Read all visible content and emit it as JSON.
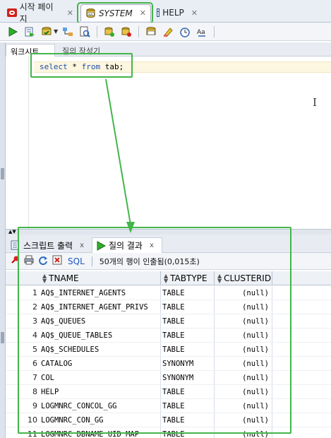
{
  "tabs": [
    {
      "label": "시작 페이지",
      "icon": "oracle-icon"
    },
    {
      "label": "SYSTEM",
      "icon": "sql-worksheet-icon",
      "active": true
    },
    {
      "label": "HELP",
      "icon": "table-icon"
    }
  ],
  "toolbar_icons": [
    "run-statement-icon",
    "run-script-icon",
    "commit-icon",
    "dropdown-icon",
    "explain-plan-icon",
    "autotrace-icon",
    "sql-tuning-icon",
    "rollback-icon",
    "unshared-sql-icon",
    "clear-icon",
    "history-icon",
    "format-case-icon"
  ],
  "subtabs": {
    "worksheet": "워크시트",
    "query_builder": "질의 작성기"
  },
  "editor": {
    "keyword_select": "select",
    "star": " * ",
    "keyword_from": "from",
    "rest": " tab;"
  },
  "results": {
    "tab_script_output": "스크립트 출력",
    "tab_query_result": "질의 결과",
    "sql_link": "SQL",
    "status": "50개의 행이 인출됨(0,015초)"
  },
  "grid": {
    "columns": [
      "TNAME",
      "TABTYPE",
      "CLUSTERID"
    ],
    "rows": [
      {
        "n": "1",
        "tname": "AQ$_INTERNET_AGENTS",
        "tabtype": "TABLE",
        "clusterid": "(null)"
      },
      {
        "n": "2",
        "tname": "AQ$_INTERNET_AGENT_PRIVS",
        "tabtype": "TABLE",
        "clusterid": "(null)"
      },
      {
        "n": "3",
        "tname": "AQ$_QUEUES",
        "tabtype": "TABLE",
        "clusterid": "(null)"
      },
      {
        "n": "4",
        "tname": "AQ$_QUEUE_TABLES",
        "tabtype": "TABLE",
        "clusterid": "(null)"
      },
      {
        "n": "5",
        "tname": "AQ$_SCHEDULES",
        "tabtype": "TABLE",
        "clusterid": "(null)"
      },
      {
        "n": "6",
        "tname": "CATALOG",
        "tabtype": "SYNONYM",
        "clusterid": "(null)"
      },
      {
        "n": "7",
        "tname": "COL",
        "tabtype": "SYNONYM",
        "clusterid": "(null)"
      },
      {
        "n": "8",
        "tname": "HELP",
        "tabtype": "TABLE",
        "clusterid": "(null)"
      },
      {
        "n": "9",
        "tname": "LOGMNRC_CONCOL_GG",
        "tabtype": "TABLE",
        "clusterid": "(null)"
      },
      {
        "n": "10",
        "tname": "LOGMNRC_CON_GG",
        "tabtype": "TABLE",
        "clusterid": "(null)"
      },
      {
        "n": "11",
        "tname": "LOGMNRC_DBNAME_UID_MAP",
        "tabtype": "TABLE",
        "clusterid": "(null)"
      }
    ]
  },
  "colors": {
    "annotation_green": "#43b54a",
    "link_blue": "#1f55c5"
  }
}
